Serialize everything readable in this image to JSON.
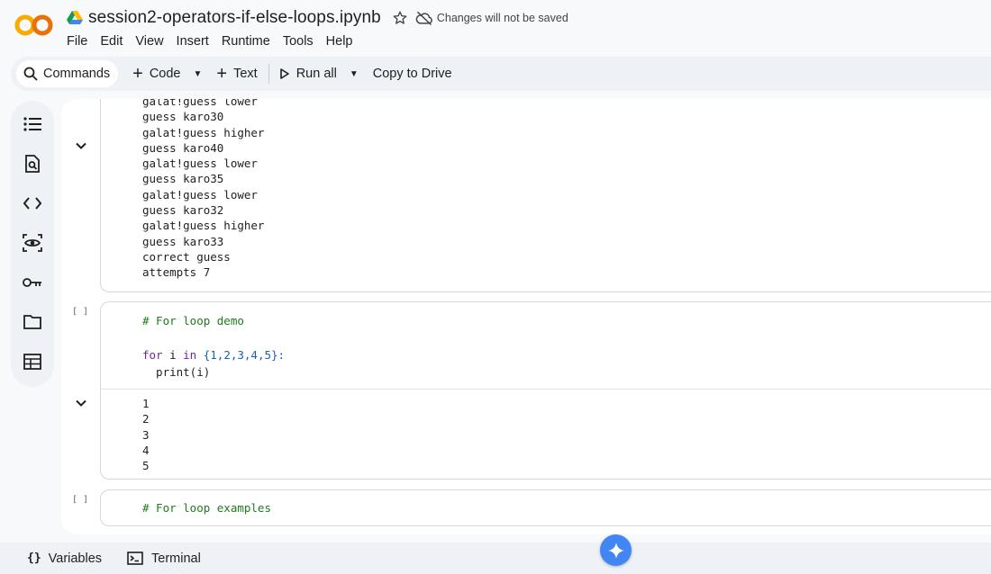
{
  "header": {
    "logo_text": "CO",
    "notebook_title": "session2-operators-if-else-loops.ipynb",
    "save_status": "Changes will not be saved",
    "menu": [
      "File",
      "Edit",
      "View",
      "Insert",
      "Runtime",
      "Tools",
      "Help"
    ]
  },
  "toolbar": {
    "commands_label": "Commands",
    "code_label": "Code",
    "text_label": "Text",
    "run_all_label": "Run all",
    "copy_to_drive_label": "Copy to Drive"
  },
  "rail": {
    "icons": [
      "table-of-contents-icon",
      "find-replace-icon",
      "code-snippets-icon",
      "variables-inspector-icon",
      "secrets-key-icon",
      "files-folder-icon",
      "data-table-icon"
    ]
  },
  "cells": {
    "output1": [
      "galat!guess lower",
      "guess karo30",
      "galat!guess higher",
      "guess karo40",
      "galat!guess lower",
      "guess karo35",
      "galat!guess lower",
      "guess karo32",
      "galat!guess higher",
      "guess karo33",
      "correct guess",
      "attempts 7"
    ],
    "cell2": {
      "bracket": "[ ]",
      "comment": "# For loop demo",
      "line1_kw1": "for",
      "line1_var": " i ",
      "line1_kw2": "in",
      "line1_set": " {1,2,3,4,5}:",
      "line2": "  print(i)",
      "output": [
        "1",
        "2",
        "3",
        "4",
        "5"
      ]
    },
    "cell3": {
      "bracket": "[ ]",
      "comment": "# For loop examples"
    }
  },
  "bottom": {
    "variables_label": "Variables",
    "terminal_label": "Terminal",
    "variables_icon_glyph": "{}"
  }
}
